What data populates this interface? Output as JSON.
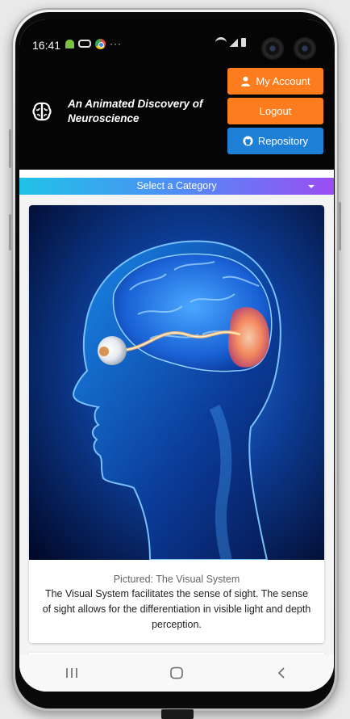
{
  "status_bar": {
    "time": "16:41",
    "more": "···"
  },
  "header": {
    "title": "An Animated Discovery of Neuroscience",
    "logo_icon": "brain-icon",
    "buttons": {
      "my_account": "My Account",
      "logout": "Logout",
      "repository": "Repository"
    }
  },
  "category_select": {
    "selected": "Select a Category"
  },
  "card": {
    "image_subject": "visual-system-illustration",
    "caption_title": "Pictured: The Visual System",
    "caption_body": "The Visual System facilitates the sense of sight. The sense of sight allows for the differentiation in visible light and depth perception."
  },
  "colors": {
    "accent_orange": "#fd7c1e",
    "accent_blue": "#1e7fd6",
    "header_bg": "#050505",
    "gradient_start": "#20c2e6",
    "gradient_end": "#9b4df2"
  },
  "navigation": {
    "recents_icon": "recents-icon",
    "home_icon": "home-icon",
    "back_icon": "back-icon"
  }
}
